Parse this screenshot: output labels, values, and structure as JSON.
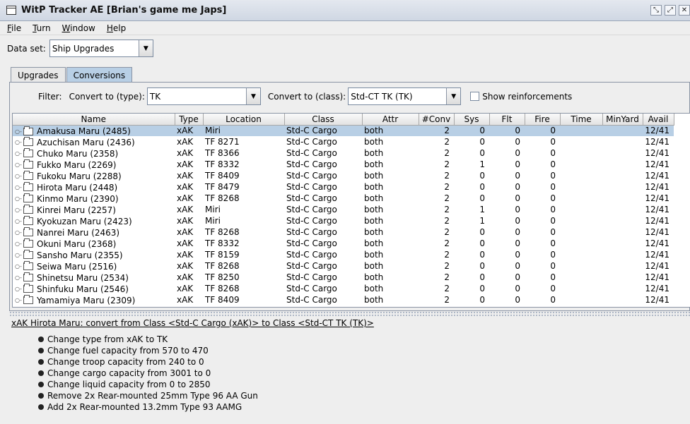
{
  "window": {
    "title": "WitP Tracker AE [Brian's game me Japs]"
  },
  "menu": [
    {
      "underline": "F",
      "rest": "ile"
    },
    {
      "underline": "T",
      "rest": "urn"
    },
    {
      "underline": "W",
      "rest": "indow"
    },
    {
      "underline": "H",
      "rest": "elp"
    }
  ],
  "dataset": {
    "label": "Data set:",
    "value": "Ship Upgrades"
  },
  "tabs": [
    {
      "label": "Upgrades"
    },
    {
      "label": "Conversions"
    }
  ],
  "active_tab": 1,
  "filter": {
    "label": "Filter:",
    "type_label": "Convert to (type):",
    "type_value": "TK",
    "class_label": "Convert to (class):",
    "class_value": "Std-CT TK (TK)",
    "reinforce_label": "Show reinforcements"
  },
  "table": {
    "columns": [
      "Name",
      "Type",
      "Location",
      "Class",
      "Attr",
      "#Conv",
      "Sys",
      "Flt",
      "Fire",
      "Time",
      "MinYard",
      "Avail"
    ],
    "rows": [
      [
        "Amakusa Maru (2485)",
        "xAK",
        "Miri",
        "Std-C Cargo",
        "both",
        "2",
        "0",
        "0",
        "0",
        "",
        "",
        "12/41"
      ],
      [
        "Azuchisan Maru (2436)",
        "xAK",
        "TF 8271",
        "Std-C Cargo",
        "both",
        "2",
        "0",
        "0",
        "0",
        "",
        "",
        "12/41"
      ],
      [
        "Chuko Maru (2358)",
        "xAK",
        "TF 8366",
        "Std-C Cargo",
        "both",
        "2",
        "0",
        "0",
        "0",
        "",
        "",
        "12/41"
      ],
      [
        "Fukko Maru (2269)",
        "xAK",
        "TF 8332",
        "Std-C Cargo",
        "both",
        "2",
        "1",
        "0",
        "0",
        "",
        "",
        "12/41"
      ],
      [
        "Fukoku Maru (2288)",
        "xAK",
        "TF 8409",
        "Std-C Cargo",
        "both",
        "2",
        "0",
        "0",
        "0",
        "",
        "",
        "12/41"
      ],
      [
        "Hirota Maru (2448)",
        "xAK",
        "TF 8479",
        "Std-C Cargo",
        "both",
        "2",
        "0",
        "0",
        "0",
        "",
        "",
        "12/41"
      ],
      [
        "Kinmo Maru (2390)",
        "xAK",
        "TF 8268",
        "Std-C Cargo",
        "both",
        "2",
        "0",
        "0",
        "0",
        "",
        "",
        "12/41"
      ],
      [
        "Kinrei Maru (2257)",
        "xAK",
        "Miri",
        "Std-C Cargo",
        "both",
        "2",
        "1",
        "0",
        "0",
        "",
        "",
        "12/41"
      ],
      [
        "Kyokuzan Maru (2423)",
        "xAK",
        "Miri",
        "Std-C Cargo",
        "both",
        "2",
        "1",
        "0",
        "0",
        "",
        "",
        "12/41"
      ],
      [
        "Nanrei Maru (2463)",
        "xAK",
        "TF 8268",
        "Std-C Cargo",
        "both",
        "2",
        "0",
        "0",
        "0",
        "",
        "",
        "12/41"
      ],
      [
        "Okuni Maru (2368)",
        "xAK",
        "TF 8332",
        "Std-C Cargo",
        "both",
        "2",
        "0",
        "0",
        "0",
        "",
        "",
        "12/41"
      ],
      [
        "Sansho Maru (2355)",
        "xAK",
        "TF 8159",
        "Std-C Cargo",
        "both",
        "2",
        "0",
        "0",
        "0",
        "",
        "",
        "12/41"
      ],
      [
        "Seiwa Maru (2516)",
        "xAK",
        "TF 8268",
        "Std-C Cargo",
        "both",
        "2",
        "0",
        "0",
        "0",
        "",
        "",
        "12/41"
      ],
      [
        "Shinetsu Maru (2534)",
        "xAK",
        "TF 8250",
        "Std-C Cargo",
        "both",
        "2",
        "0",
        "0",
        "0",
        "",
        "",
        "12/41"
      ],
      [
        "Shinfuku Maru (2546)",
        "xAK",
        "TF 8268",
        "Std-C Cargo",
        "both",
        "2",
        "0",
        "0",
        "0",
        "",
        "",
        "12/41"
      ],
      [
        "Yamamiya Maru (2309)",
        "xAK",
        "TF 8409",
        "Std-C Cargo",
        "both",
        "2",
        "0",
        "0",
        "0",
        "",
        "",
        "12/41"
      ]
    ],
    "selected_row": 0
  },
  "details": {
    "heading": "xAK Hirota Maru: convert from Class <Std-C Cargo (xAK)> to Class <Std-CT TK (TK)>",
    "items": [
      "Change type from xAK to TK",
      "Change fuel capacity from 570 to 470",
      "Change troop capacity from 240 to 0",
      "Change cargo capacity from 3001 to 0",
      "Change liquid capacity from 0 to 2850",
      "Remove 2x Rear-mounted 25mm Type 96 AA Gun",
      "Add 2x Rear-mounted 13.2mm Type 93 AAMG"
    ]
  },
  "colors": {
    "selection": "#b8cfe5",
    "active_tab": "#b8cfe5"
  }
}
